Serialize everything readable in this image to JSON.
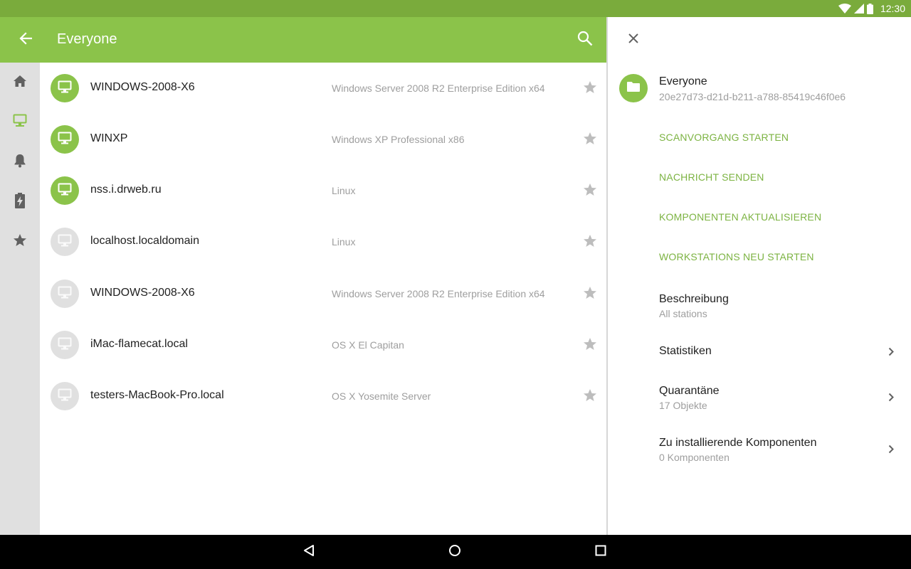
{
  "status": {
    "time": "12:30"
  },
  "appbar": {
    "title": "Everyone"
  },
  "rail": {
    "items": [
      {
        "icon": "home-icon"
      },
      {
        "icon": "computer-icon",
        "active": true
      },
      {
        "icon": "bell-icon"
      },
      {
        "icon": "battery-bolt-icon"
      },
      {
        "icon": "star-icon"
      }
    ]
  },
  "stations": [
    {
      "name": "WINDOWS-2008-X6",
      "os": "Windows Server 2008 R2 Enterprise Edition x64",
      "online": true
    },
    {
      "name": "WINXP",
      "os": "Windows XP Professional x86",
      "online": true
    },
    {
      "name": "nss.i.drweb.ru",
      "os": "Linux",
      "online": true
    },
    {
      "name": "localhost.localdomain",
      "os": "Linux",
      "online": false
    },
    {
      "name": "WINDOWS-2008-X6",
      "os": "Windows Server 2008 R2 Enterprise Edition x64",
      "online": false
    },
    {
      "name": "iMac-flamecat.local",
      "os": "OS X El Capitan",
      "online": false
    },
    {
      "name": "testers-MacBook-Pro.local",
      "os": "OS X Yosemite Server",
      "online": false
    }
  ],
  "panel": {
    "title": "Everyone",
    "id": "20e27d73-d21d-b211-a788-85419c46f0e6",
    "actions": [
      "SCANVORGANG STARTEN",
      "NACHRICHT SENDEN",
      "KOMPONENTEN AKTUALISIEREN",
      "WORKSTATIONS NEU STARTEN"
    ],
    "description": {
      "title": "Beschreibung",
      "value": "All stations"
    },
    "statistics": {
      "title": "Statistiken"
    },
    "quarantine": {
      "title": "Quarantäne",
      "value": "17 Objekte"
    },
    "components": {
      "title": "Zu installierende Komponenten",
      "value": "0 Komponenten"
    }
  },
  "colors": {
    "accent": "#8bc34a",
    "accent_dark": "#7aab3c",
    "action_text": "#7cb342",
    "rail_bg": "#e0e0e0"
  }
}
